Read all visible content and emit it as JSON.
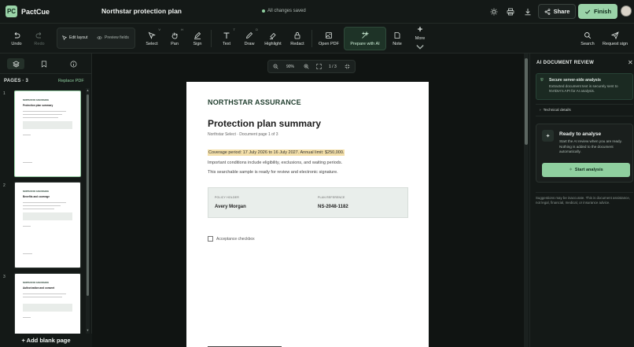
{
  "app": {
    "logo_mark": "PC",
    "name": "PactCue"
  },
  "document": {
    "title": "Northstar protection plan",
    "save_status": "All changes saved"
  },
  "header": {
    "icons": [
      "sun-icon",
      "printer-icon",
      "download-icon"
    ],
    "share_label": "Share",
    "finish_label": "Finish"
  },
  "toolbar": {
    "undo": "Undo",
    "redo": "Redo",
    "edit_layout": "Edit layout",
    "preview_fields": "Preview fields",
    "select": "Select",
    "select_key": "V",
    "pan": "Pan",
    "pan_key": "H",
    "sign": "Sign",
    "text": "Text",
    "text_key": "T",
    "draw": "Draw",
    "draw_key": "D",
    "highlight": "Highlight",
    "redact": "Redact",
    "open_pdf": "Open PDF",
    "prepare_ai": "Prepare with AI",
    "note": "Note",
    "more": "More",
    "search": "Search",
    "request_sign": "Request sign"
  },
  "sidebar": {
    "pages_label": "PAGES · 3",
    "replace_pdf": "Replace PDF",
    "add_blank": "+ Add blank page",
    "thumbnails": [
      {
        "num": "1",
        "brand": "NORTHSTAR ASSURANCE",
        "title": "Protection plan summary"
      },
      {
        "num": "2",
        "brand": "NORTHSTAR ASSURANCE",
        "title": "Benefits and coverage"
      },
      {
        "num": "3",
        "brand": "NORTHSTAR ASSURANCE",
        "title": "Authorization and consent"
      }
    ]
  },
  "zoom": {
    "level": "90%",
    "page_indicator": "1 / 3"
  },
  "page": {
    "brand": "NORTHSTAR ASSURANCE",
    "title": "Protection plan summary",
    "subtitle": "Northstar Select · Document page 1 of 3",
    "coverage": "Coverage period: 17 July 2026 to 16 July 2027. Annual limit: $250,000.",
    "line1": "Important conditions include eligibility, exclusions, and waiting periods.",
    "line2": "This searchable sample is ready for review and electronic signature.",
    "holder_label": "POLICY HOLDER",
    "holder_value": "Avery Morgan",
    "ref_label": "PLAN REFERENCE",
    "ref_value": "NS-2048-1182",
    "checkbox_label": "Acceptance checkbox"
  },
  "ai_panel": {
    "title": "AI DOCUMENT REVIEW",
    "secure_title": "Secure server-side analysis",
    "secure_text": "Extracted document text is securely sent to NVIDIA's API for AI analysis.",
    "technical": "Technical details",
    "ready_title": "Ready to analyse",
    "ready_text": "Start the AI review when you are ready. Nothing is added to the document automatically.",
    "start_label": "Start analysis",
    "footer": "Suggestions may be inaccurate. This is document assistance, not legal, financial, medical, or insurance advice."
  },
  "colors": {
    "accent": "#9ad3a8",
    "background": "#101412",
    "panel": "#141917",
    "highlight": "#f3dfa9"
  }
}
